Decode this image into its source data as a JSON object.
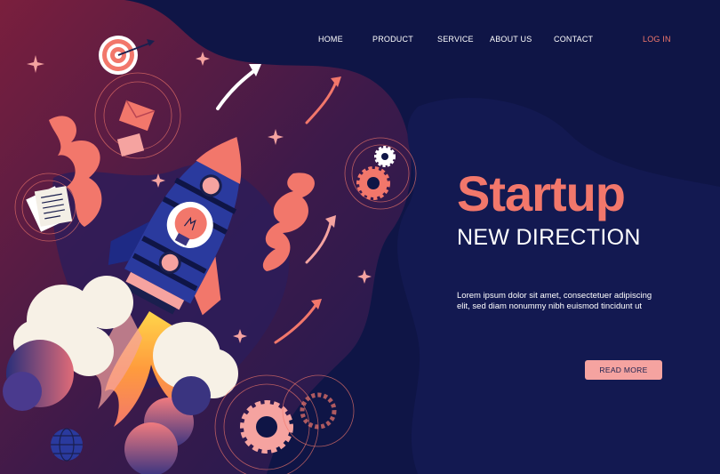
{
  "nav": {
    "items": [
      {
        "label": "HOME"
      },
      {
        "label": "PRODUCT"
      },
      {
        "label": "SERVICE"
      },
      {
        "label": "ABOUT US"
      },
      {
        "label": "CONTACT"
      }
    ],
    "login_label": "LOG IN"
  },
  "hero": {
    "title": "Startup",
    "subtitle": "NEW DIRECTION",
    "body": "Lorem ipsum dolor sit amet, consectetuer adipiscing elit, sed diam nonummy nibh euismod tincidunt ut",
    "button_label": "READ MORE"
  },
  "colors": {
    "background": "#0f1546",
    "accent_coral": "#f2776b",
    "button_pink": "#f5a3a0",
    "text_white": "#ffffff"
  },
  "icons": [
    "target-icon",
    "envelope-icon",
    "documents-icon",
    "gear-icon",
    "rocket-illustration",
    "lightbulb-icon",
    "arrow-icon",
    "sparkle-icon",
    "globe-icon"
  ]
}
